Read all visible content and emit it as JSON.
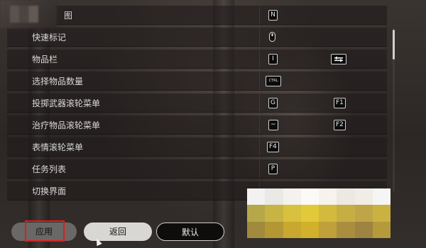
{
  "rows": [
    {
      "label": "图",
      "key1": "N",
      "key2": ""
    },
    {
      "label": "快速标记",
      "key1": "mouse-middle",
      "key2": ""
    },
    {
      "label": "物品栏",
      "key1": "I",
      "key2": "controller-icon"
    },
    {
      "label": "选择物品数量",
      "key1": "CTRL",
      "key2": ""
    },
    {
      "label": "投掷武器滚轮菜单",
      "key1": "G",
      "key2": "F1"
    },
    {
      "label": "治疗物品滚轮菜单",
      "key1": "~",
      "key2": "F2"
    },
    {
      "label": "表情滚轮菜单",
      "key1": "F4",
      "key2": ""
    },
    {
      "label": "任务列表",
      "key1": "P",
      "key2": ""
    },
    {
      "label": "切换界面",
      "key1": "",
      "key2": ""
    }
  ],
  "buttons": {
    "apply": "应用",
    "back": "返回",
    "default": "默认"
  },
  "colors": {
    "highlight": "#e21b1b"
  }
}
